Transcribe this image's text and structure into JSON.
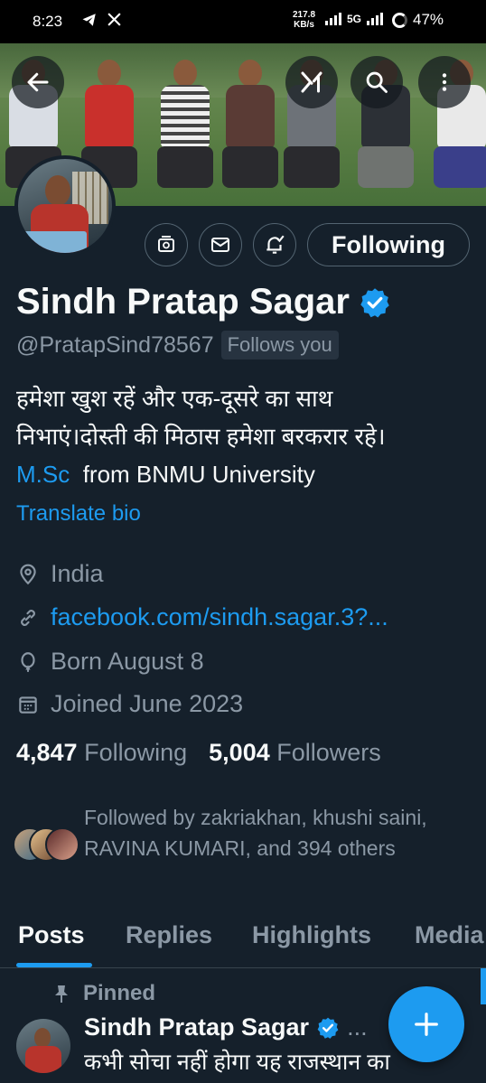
{
  "status_bar": {
    "time": "8:23",
    "speed_value": "217.8",
    "speed_unit": "KB/s",
    "network": "5G",
    "battery": "47%"
  },
  "banner_buttons": {
    "back": "back-arrow-icon",
    "grok": "grok-icon",
    "search": "search-icon",
    "more": "more-vertical-icon"
  },
  "actions": {
    "following_label": "Following"
  },
  "profile": {
    "name": "Sindh Pratap Sagar",
    "handle": "@PratapSind78567",
    "follows_you": "Follows you",
    "bio_line1": "हमेशा खुश रहें और एक-दूसरे का साथ",
    "bio_line2": "निभाएं।दोस्ती की मिठास हमेशा बरकरार रहे।",
    "bio_link": "M.Sc",
    "bio_rest": "from BNMU University",
    "translate": "Translate bio",
    "location": "India",
    "website": "facebook.com/sindh.sagar.3?...",
    "birthday": "Born August 8",
    "joined": "Joined June 2023",
    "following_count": "4,847",
    "following_label": "Following",
    "followers_count": "5,004",
    "followers_label": "Followers",
    "followed_by": "Followed by zakriakhan, khushi saini, RAVINA KUMARI, and 394 others"
  },
  "tabs": [
    "Posts",
    "Replies",
    "Highlights",
    "Media"
  ],
  "pinned_post": {
    "pinned_label": "Pinned",
    "author": "Sindh Pratap Sagar",
    "more": "...",
    "text": "कभी सोचा नहीं होगा यह राजस्थान का"
  },
  "colors": {
    "background": "#15202b",
    "accent": "#1d9bf0",
    "muted_text": "#8b98a5"
  }
}
